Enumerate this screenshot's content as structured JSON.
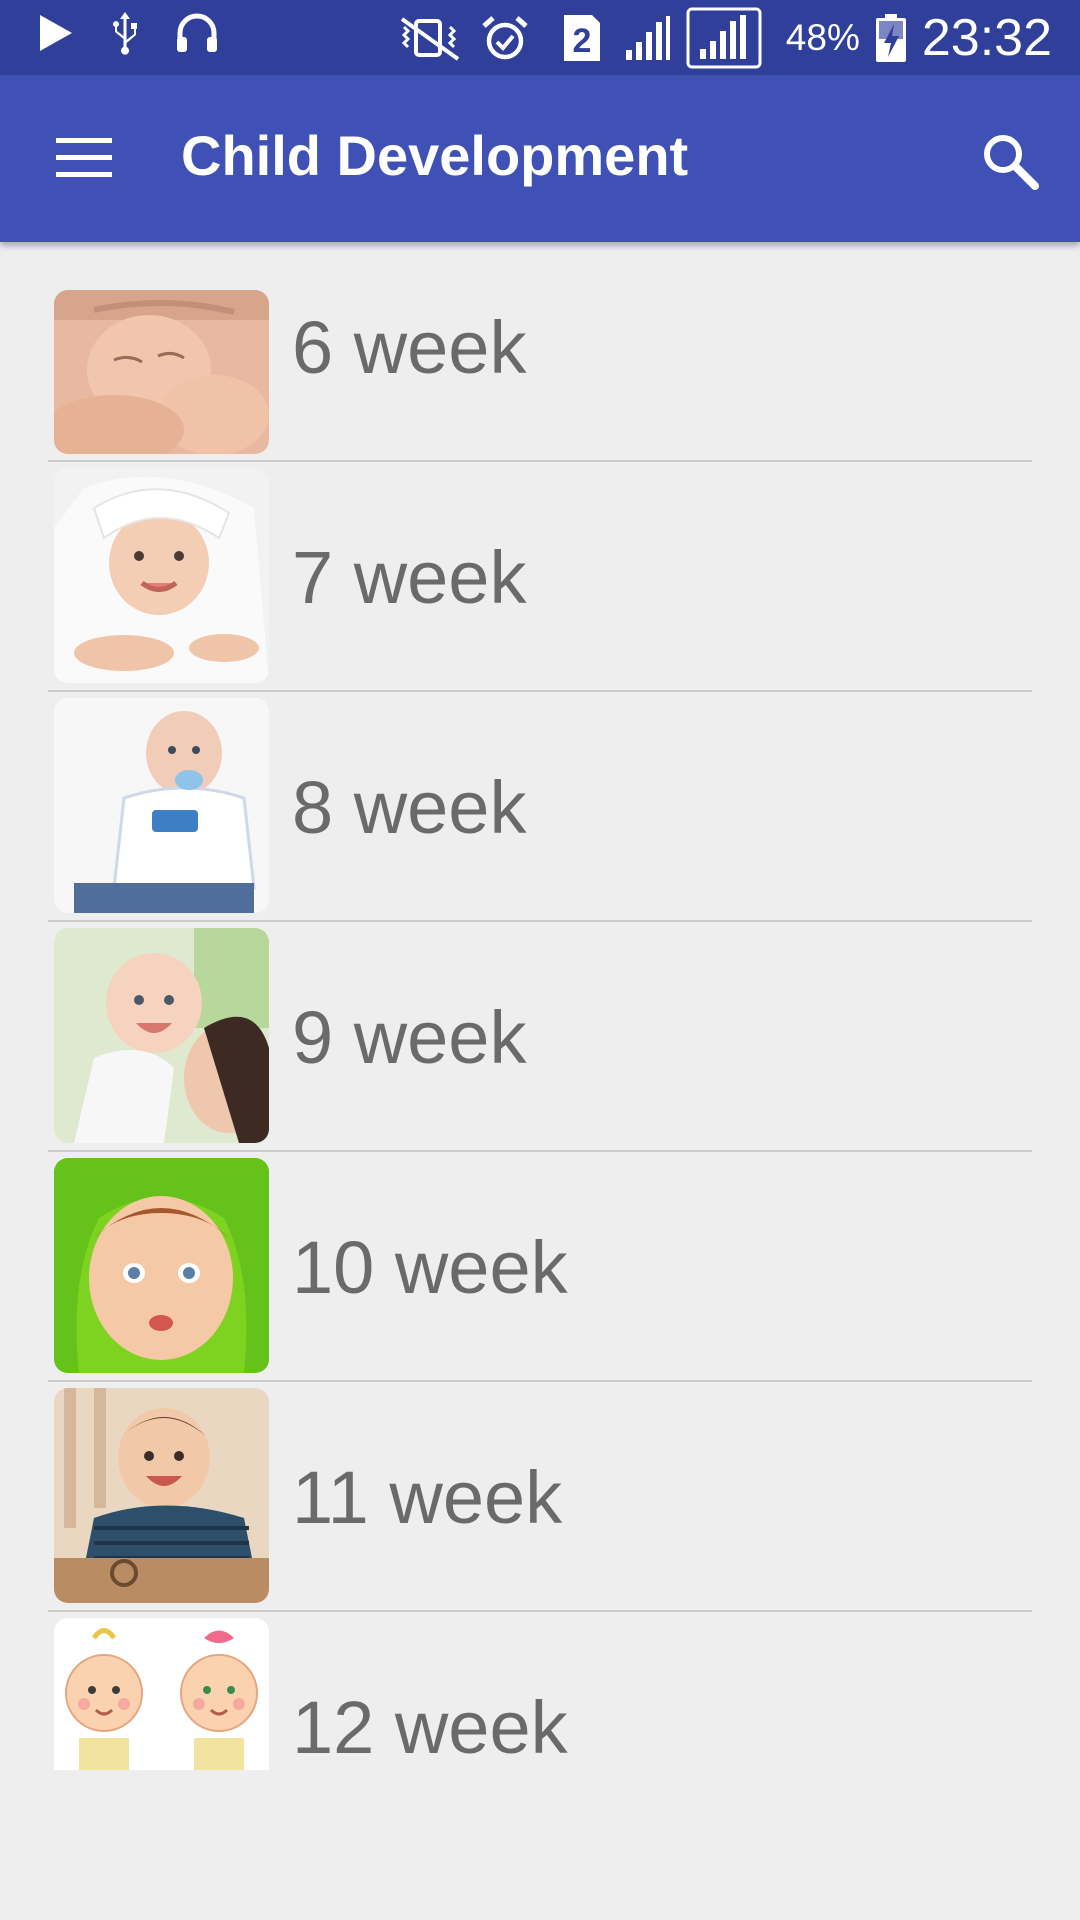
{
  "status_bar": {
    "sim_slot": "2",
    "battery_percent": "48%",
    "time": "23:32",
    "icons": [
      "play-icon",
      "usb-icon",
      "headset-icon",
      "vibrate-off-icon",
      "alarm-icon",
      "sim-2-icon",
      "signal-icon",
      "signal-icon",
      "battery-charging-icon"
    ]
  },
  "app_bar": {
    "title": "Child Development",
    "menu_icon": "menu-icon",
    "search_icon": "search-icon"
  },
  "colors": {
    "status_bar": "#30409a",
    "app_bar": "#3f51b5",
    "background": "#eeeeee",
    "label_text": "#6a6a6a",
    "divider": "#cccccc"
  },
  "weeks": [
    {
      "label": "6 week",
      "image": "sleeping-newborn-photo"
    },
    {
      "label": "7 week",
      "image": "baby-under-towel-photo"
    },
    {
      "label": "8 week",
      "image": "baby-with-pacifier-photo"
    },
    {
      "label": "9 week",
      "image": "baby-with-mother-photo"
    },
    {
      "label": "10 week",
      "image": "baby-green-towel-photo"
    },
    {
      "label": "11 week",
      "image": "baby-in-crib-photo"
    },
    {
      "label": "12 week",
      "image": "cartoon-babies-illustration"
    }
  ]
}
